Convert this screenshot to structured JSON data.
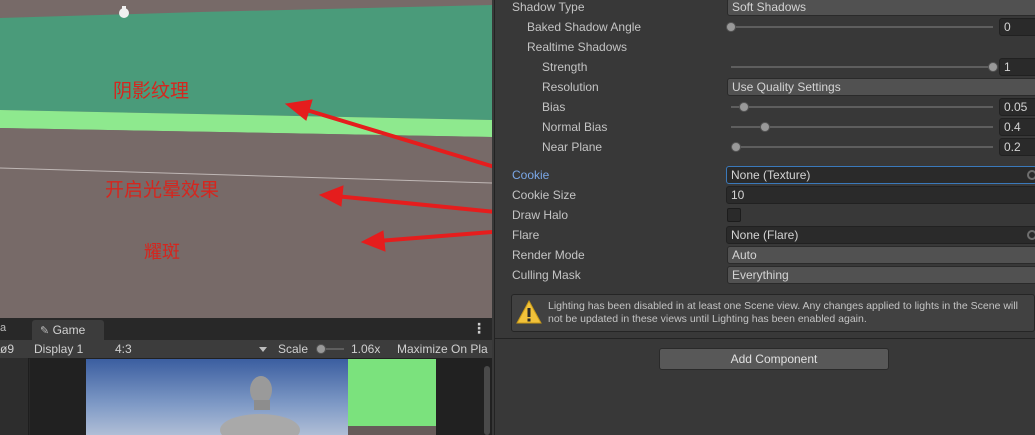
{
  "scene": {
    "annotations": {
      "shadow_texture": "阴影纹理",
      "halo_effect": "开启光晕效果",
      "flare": "耀斑"
    },
    "colors": {
      "green_plane": "#4a9b7a",
      "light_green_band": "#8ee98e",
      "ground": "#776a68",
      "annotation_red": "#d5261e"
    }
  },
  "game_view": {
    "tab_label": "Game",
    "left_counter": "9",
    "display": "Display 1",
    "aspect": "4:3",
    "scale_label": "Scale",
    "scale_value": "1.06x",
    "maximize": "Maximize On Pla"
  },
  "inspector": {
    "shadow_type": {
      "label": "Shadow Type",
      "value": "Soft Shadows"
    },
    "baked_shadow_angle": {
      "label": "Baked Shadow Angle",
      "value": "0",
      "fraction": 0.0
    },
    "realtime_shadows": {
      "label": "Realtime Shadows"
    },
    "strength": {
      "label": "Strength",
      "value": "1",
      "fraction": 1.0
    },
    "resolution": {
      "label": "Resolution",
      "value": "Use Quality Settings"
    },
    "bias": {
      "label": "Bias",
      "value": "0.05",
      "fraction": 0.05
    },
    "normal_bias": {
      "label": "Normal Bias",
      "value": "0.4",
      "fraction": 0.13
    },
    "near_plane": {
      "label": "Near Plane",
      "value": "0.2",
      "fraction": 0.02
    },
    "cookie": {
      "label": "Cookie",
      "value": "None (Texture)"
    },
    "cookie_size": {
      "label": "Cookie Size",
      "value": "10"
    },
    "draw_halo": {
      "label": "Draw Halo",
      "checked": false
    },
    "flare": {
      "label": "Flare",
      "value": "None (Flare)"
    },
    "render_mode": {
      "label": "Render Mode",
      "value": "Auto"
    },
    "culling_mask": {
      "label": "Culling Mask",
      "value": "Everything"
    },
    "help_text": "Lighting has been disabled in at least one Scene view. Any changes applied to lights in the Scene will not be updated in these views until Lighting has been enabled again.",
    "add_component": "Add Component",
    "colors": {
      "cookie_label": "#7aa7e6",
      "focus_border": "#3a79bb"
    }
  }
}
